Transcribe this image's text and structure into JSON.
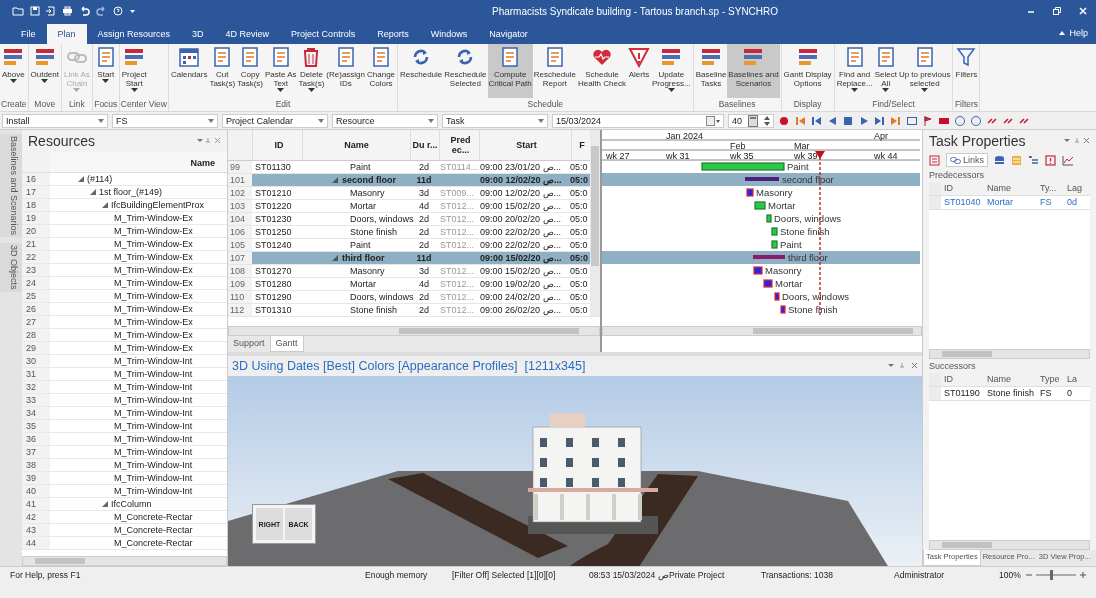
{
  "window": {
    "title": "Pharmacists Syndicate building - Tartous branch.sp - SYNCHRO"
  },
  "ribbon_tabs": [
    {
      "label": "File",
      "selected": false
    },
    {
      "label": "Plan",
      "selected": true
    },
    {
      "label": "Assign Resources",
      "selected": false
    },
    {
      "label": "3D",
      "selected": false
    },
    {
      "label": "4D Review",
      "selected": false
    },
    {
      "label": "Project Controls",
      "selected": false
    },
    {
      "label": "Reports",
      "selected": false
    },
    {
      "label": "Windows",
      "selected": false
    },
    {
      "label": "Navigator",
      "selected": false
    }
  ],
  "help": "Help",
  "ribbon_groups": [
    {
      "label": "Create",
      "buttons": [
        {
          "lines": [
            "Above"
          ],
          "dropdown": true,
          "selected": false,
          "disabled": false
        }
      ]
    },
    {
      "label": "Move",
      "buttons": [
        {
          "lines": [
            "Outdent"
          ],
          "dropdown": true,
          "selected": false,
          "disabled": false
        }
      ]
    },
    {
      "label": "Link",
      "buttons": [
        {
          "lines": [
            "Link As",
            "Chain"
          ],
          "dropdown": true,
          "selected": false,
          "disabled": true
        }
      ]
    },
    {
      "label": "Focus",
      "buttons": [
        {
          "lines": [
            "Start"
          ],
          "dropdown": true,
          "selected": false,
          "disabled": false
        }
      ]
    },
    {
      "label": "Center View",
      "buttons": [
        {
          "lines": [
            "Project",
            "Start"
          ],
          "dropdown": true,
          "selected": false,
          "disabled": false
        }
      ]
    },
    {
      "label": "Edit",
      "buttons": [
        {
          "lines": [
            "Calendars"
          ],
          "dropdown": false,
          "selected": false,
          "disabled": false
        },
        {
          "lines": [
            "Cut",
            "Task(s)"
          ],
          "dropdown": false,
          "selected": false,
          "disabled": false
        },
        {
          "lines": [
            "Copy",
            "Task(s)"
          ],
          "dropdown": false,
          "selected": false,
          "disabled": false
        },
        {
          "lines": [
            "Paste As",
            "Text"
          ],
          "dropdown": true,
          "selected": false,
          "disabled": false
        },
        {
          "lines": [
            "Delete",
            "Task(s)"
          ],
          "dropdown": true,
          "selected": false,
          "disabled": false
        },
        {
          "lines": [
            "(Re)assign",
            "IDs"
          ],
          "dropdown": false,
          "selected": false,
          "disabled": false
        },
        {
          "lines": [
            "Change",
            "Colors"
          ],
          "dropdown": false,
          "selected": false,
          "disabled": false
        }
      ]
    },
    {
      "label": "Schedule",
      "buttons": [
        {
          "lines": [
            "Reschedule"
          ],
          "dropdown": false,
          "selected": false,
          "disabled": false
        },
        {
          "lines": [
            "Reschedule",
            "Selected"
          ],
          "dropdown": false,
          "selected": false,
          "disabled": false
        },
        {
          "lines": [
            "Compute",
            "Critical Path"
          ],
          "dropdown": false,
          "selected": true,
          "disabled": false
        },
        {
          "lines": [
            "Reschedule",
            "Report"
          ],
          "dropdown": false,
          "selected": false,
          "disabled": false
        },
        {
          "lines": [
            "Schedule",
            "Health Check"
          ],
          "dropdown": false,
          "selected": false,
          "disabled": false
        },
        {
          "lines": [
            "Alerts"
          ],
          "dropdown": false,
          "selected": false,
          "disabled": false
        },
        {
          "lines": [
            "Update",
            "Progress..."
          ],
          "dropdown": true,
          "selected": false,
          "disabled": false
        }
      ]
    },
    {
      "label": "Baselines",
      "buttons": [
        {
          "lines": [
            "Baseline",
            "Tasks"
          ],
          "dropdown": false,
          "selected": false,
          "disabled": false
        },
        {
          "lines": [
            "Baselines and",
            "Scenarios"
          ],
          "dropdown": false,
          "selected": true,
          "disabled": false
        }
      ]
    },
    {
      "label": "Display",
      "buttons": [
        {
          "lines": [
            "Gantt Display",
            "Options"
          ],
          "dropdown": false,
          "selected": false,
          "disabled": false
        }
      ]
    },
    {
      "label": "Find/Select",
      "buttons": [
        {
          "lines": [
            "Find and",
            "Replace..."
          ],
          "dropdown": true,
          "selected": false,
          "disabled": false
        },
        {
          "lines": [
            "Select",
            "All"
          ],
          "dropdown": true,
          "selected": false,
          "disabled": false
        },
        {
          "lines": [
            "Up to previous",
            "selected"
          ],
          "dropdown": true,
          "selected": false,
          "disabled": false
        }
      ]
    },
    {
      "label": "Filters",
      "buttons": [
        {
          "lines": [
            "Filters"
          ],
          "dropdown": false,
          "selected": false,
          "disabled": false
        }
      ]
    }
  ],
  "toolbar": {
    "combos": [
      "Install",
      "FS",
      "Project Calendar",
      "Resource",
      "Task"
    ],
    "date": "15/03/2024",
    "number": "40"
  },
  "side_tabs": [
    "Baselines and Scenarios",
    "3D Objects"
  ],
  "resources": {
    "title": "Resources",
    "column": "Name",
    "tree": [
      {
        "num": "16",
        "name": "(#114)",
        "expanded": true,
        "children": [
          {
            "num": "17",
            "name": "1st floor_(#149)",
            "expanded": true,
            "children": [
              {
                "num": "18",
                "name": "IfcBuildingElementProx",
                "expanded": true,
                "children": [
                  {
                    "num": "19",
                    "name": "M_Trim-Window-Ex"
                  },
                  {
                    "num": "20",
                    "name": "M_Trim-Window-Ex"
                  },
                  {
                    "num": "21",
                    "name": "M_Trim-Window-Ex"
                  },
                  {
                    "num": "22",
                    "name": "M_Trim-Window-Ex"
                  },
                  {
                    "num": "23",
                    "name": "M_Trim-Window-Ex"
                  },
                  {
                    "num": "24",
                    "name": "M_Trim-Window-Ex"
                  },
                  {
                    "num": "25",
                    "name": "M_Trim-Window-Ex"
                  },
                  {
                    "num": "26",
                    "name": "M_Trim-Window-Ex"
                  },
                  {
                    "num": "27",
                    "name": "M_Trim-Window-Ex"
                  },
                  {
                    "num": "28",
                    "name": "M_Trim-Window-Ex"
                  },
                  {
                    "num": "29",
                    "name": "M_Trim-Window-Ex"
                  },
                  {
                    "num": "30",
                    "name": "M_Trim-Window-Int"
                  },
                  {
                    "num": "31",
                    "name": "M_Trim-Window-Int"
                  },
                  {
                    "num": "32",
                    "name": "M_Trim-Window-Int"
                  },
                  {
                    "num": "33",
                    "name": "M_Trim-Window-Int"
                  },
                  {
                    "num": "34",
                    "name": "M_Trim-Window-Int"
                  },
                  {
                    "num": "35",
                    "name": "M_Trim-Window-Int"
                  },
                  {
                    "num": "36",
                    "name": "M_Trim-Window-Int"
                  },
                  {
                    "num": "37",
                    "name": "M_Trim-Window-Int"
                  },
                  {
                    "num": "38",
                    "name": "M_Trim-Window-Int"
                  },
                  {
                    "num": "39",
                    "name": "M_Trim-Window-Int"
                  },
                  {
                    "num": "40",
                    "name": "M_Trim-Window-Int"
                  }
                ]
              },
              {
                "num": "41",
                "name": "IfcColumn",
                "expanded": true,
                "children": [
                  {
                    "num": "42",
                    "name": "M_Concrete-Rectar"
                  },
                  {
                    "num": "43",
                    "name": "M_Concrete-Rectar"
                  },
                  {
                    "num": "44",
                    "name": "M_Concrete-Rectar"
                  }
                ]
              }
            ]
          }
        ]
      }
    ]
  },
  "schedule": {
    "columns": [
      "ID",
      "Name",
      "Du r...",
      "Pred ec...",
      "Start",
      "F"
    ],
    "rows": [
      {
        "num": "99",
        "kind": "task",
        "id": "ST01130",
        "name": "Paint",
        "dur": "2d",
        "pred": "ST0114...",
        "start": "09:00 23/01/20 ص...",
        "finish": "05:0"
      },
      {
        "num": "101",
        "kind": "summary",
        "expanded": true,
        "name": "second floor",
        "dur": "11d",
        "start": "09:00 12/02/20 ص...",
        "finish": "05:0"
      },
      {
        "num": "102",
        "kind": "task",
        "id": "ST01210",
        "name": "Masonry",
        "dur": "3d",
        "pred": "ST009...",
        "start": "09:00 12/02/20 ص...",
        "finish": "05:0"
      },
      {
        "num": "103",
        "kind": "task",
        "id": "ST01220",
        "name": "Mortar",
        "dur": "4d",
        "pred": "ST012...",
        "start": "09:00 15/02/20 ص...",
        "finish": "05:0"
      },
      {
        "num": "104",
        "kind": "task",
        "id": "ST01230",
        "name": "Doors, windows",
        "dur": "2d",
        "pred": "ST012...",
        "start": "09:00 20/02/20 ص...",
        "finish": "05:0"
      },
      {
        "num": "106",
        "kind": "task",
        "id": "ST01250",
        "name": "Stone finish",
        "dur": "2d",
        "pred": "ST012...",
        "start": "09:00 22/02/20 ص...",
        "finish": "05:0"
      },
      {
        "num": "105",
        "kind": "task",
        "id": "ST01240",
        "name": "Paint",
        "dur": "2d",
        "pred": "ST012...",
        "start": "09:00 22/02/20 ص...",
        "finish": "05:0"
      },
      {
        "num": "107",
        "kind": "summary",
        "expanded": true,
        "name": "third floor",
        "dur": "11d",
        "start": "09:00 15/02/20 ص...",
        "finish": "05:0"
      },
      {
        "num": "108",
        "kind": "task",
        "id": "ST01270",
        "name": "Masonry",
        "dur": "3d",
        "pred": "ST012...",
        "start": "09:00 15/02/20 ص...",
        "finish": "05:0"
      },
      {
        "num": "109",
        "kind": "task",
        "id": "ST01280",
        "name": "Mortar",
        "dur": "4d",
        "pred": "ST012...",
        "start": "09:00 19/02/20 ص...",
        "finish": "05:0"
      },
      {
        "num": "110",
        "kind": "task",
        "id": "ST01290",
        "name": "Doors, windows",
        "dur": "2d",
        "pred": "ST012...",
        "start": "09:00 24/02/20 ص...",
        "finish": "05:0"
      },
      {
        "num": "112",
        "kind": "task",
        "id": "ST01310",
        "name": "Stone finish",
        "dur": "2d",
        "pred": "ST012...",
        "start": "09:00 26/02/20 ص...",
        "finish": "05:0"
      }
    ],
    "tabs": [
      {
        "label": "Support",
        "selected": false
      },
      {
        "label": "Gantt",
        "selected": true
      }
    ]
  },
  "gantt": {
    "months": [
      "Jan 2024",
      "Feb",
      "Mar",
      "Apr"
    ],
    "weeks": [
      "wk 27",
      "wk 31",
      "wk 35",
      "wk 39",
      "wk 44"
    ],
    "bars": [
      {
        "label": "Paint",
        "kind": "task",
        "critical": false
      },
      {
        "label": "second floor",
        "kind": "summary",
        "critical": false
      },
      {
        "label": "Masonry",
        "kind": "task",
        "critical": true
      },
      {
        "label": "Mortar",
        "kind": "task",
        "critical": false
      },
      {
        "label": "Doors, windows",
        "kind": "task",
        "critical": false
      },
      {
        "label": "Stone finish",
        "kind": "task",
        "critical": false
      },
      {
        "label": "Paint",
        "kind": "task",
        "critical": false
      },
      {
        "label": "third floor",
        "kind": "summary",
        "critical": true
      },
      {
        "label": "Masonry",
        "kind": "task",
        "critical": true
      },
      {
        "label": "Mortar",
        "kind": "task",
        "critical": true
      },
      {
        "label": "Doors, windows",
        "kind": "task",
        "critical": true
      },
      {
        "label": "Stone finish",
        "kind": "task",
        "critical": true
      }
    ]
  },
  "view3d": {
    "title": "3D Using Dates [Best] Colors [Appearance Profiles]  [1211x345]",
    "cube_faces": [
      "RIGHT",
      "BACK"
    ]
  },
  "task_properties": {
    "title": "Task Properties",
    "tab": {
      "label": "Links",
      "selected": true
    },
    "predecessors": {
      "label": "Predecessors",
      "columns": [
        "ID",
        "Name",
        "Ty...",
        "Lag"
      ],
      "rows": [
        {
          "id": "ST01040",
          "name": "Mortar",
          "type": "FS",
          "lag": "0d"
        }
      ]
    },
    "successors": {
      "label": "Successors",
      "columns": [
        "ID",
        "Name",
        "Type",
        "La"
      ],
      "rows": [
        {
          "id": "ST01190",
          "name": "Stone finish",
          "type": "FS",
          "lag": "0"
        }
      ]
    },
    "bottom_tabs": [
      {
        "label": "Task Properties",
        "selected": true
      },
      {
        "label": "Resource Pro...",
        "selected": false
      },
      {
        "label": "3D View Prop...",
        "selected": false
      }
    ]
  },
  "status_bar": {
    "help": "For Help, press F1",
    "memory": "Enough memory",
    "selection": "[Filter Off]  Selected [1][0][0]",
    "datetime": "08:53 15/03/2024 ص",
    "project": "Private Project",
    "transactions": "Transactions: 1038",
    "user": "Administrator",
    "zoom": "100%",
    "zoom_slider": {
      "level": 0.35
    }
  }
}
